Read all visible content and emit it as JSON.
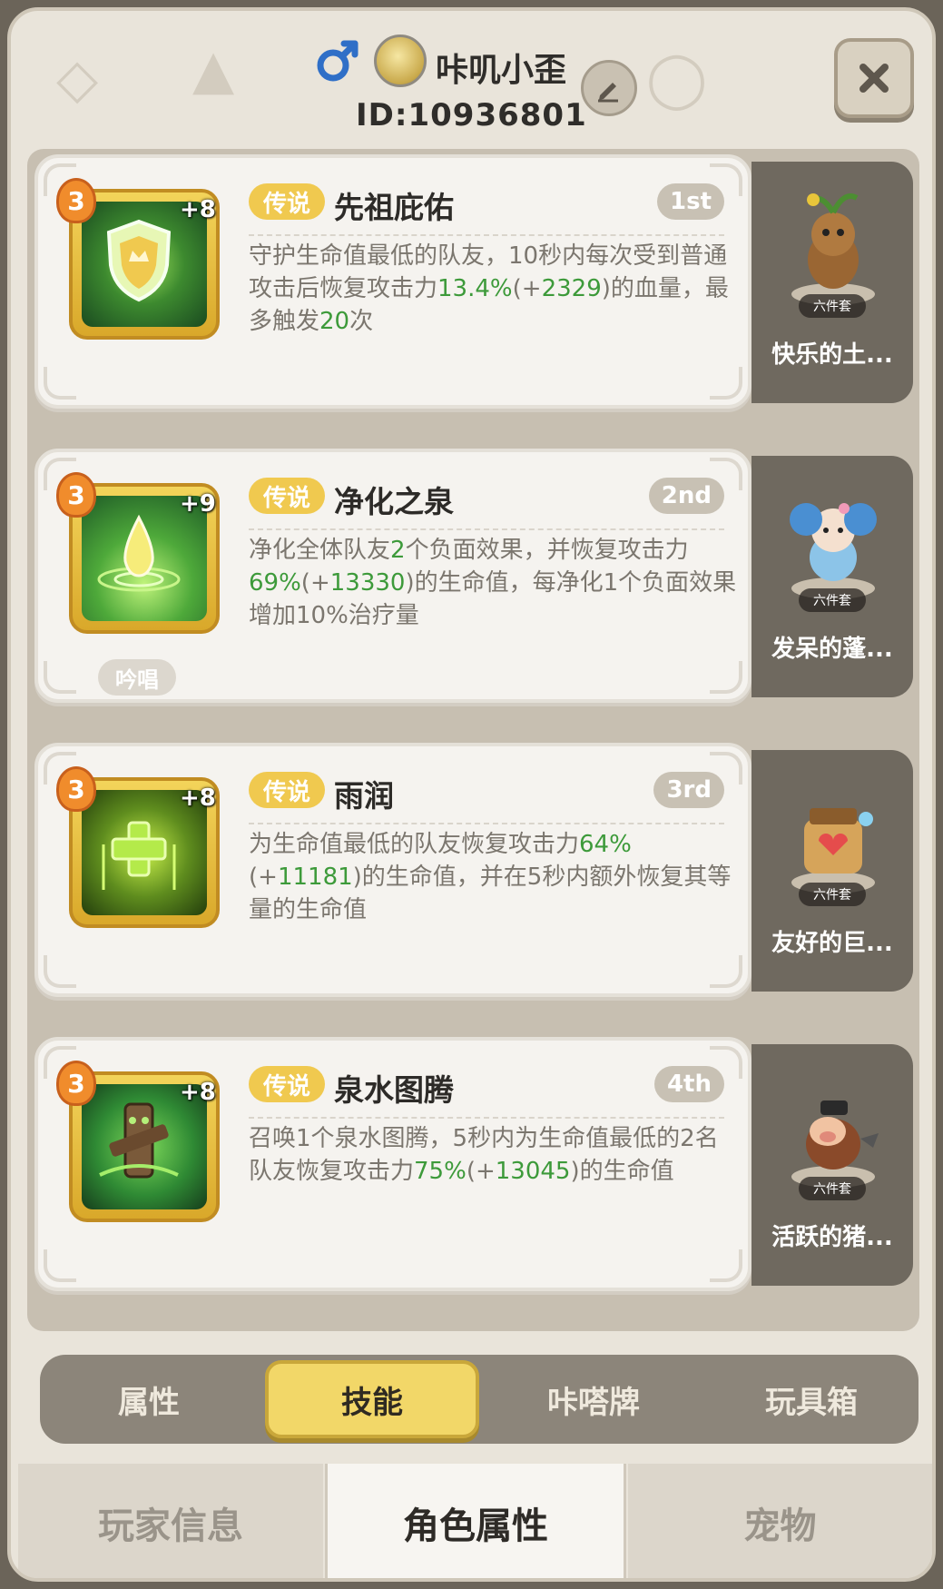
{
  "header": {
    "player_name": "咔叽小歪",
    "player_id": "ID:10936801",
    "gender": "male",
    "icons": {
      "gender": "male-symbol-icon",
      "edit": "pencil-icon",
      "close": "close-icon"
    }
  },
  "skills": [
    {
      "level": "3",
      "plus": "+8",
      "rarity": "传说",
      "name": "先祖庇佑",
      "rank": "1st",
      "desc_parts": [
        {
          "t": "守护生命值最低的队友，10秒内每次受到普通攻击后恢复攻击力"
        },
        {
          "t": "13.4%",
          "hl": true
        },
        {
          "t": "(+"
        },
        {
          "t": "2329",
          "hl": true
        },
        {
          "t": ")的血量，最多触发"
        },
        {
          "t": "20",
          "hl": true
        },
        {
          "t": "次"
        }
      ],
      "chant": "",
      "pet": {
        "set_tag": "六件套",
        "name": "快乐的土..."
      },
      "icon_colors": [
        "#1f5d2a",
        "#7fd34a"
      ],
      "icon_name": "shield-crown-icon"
    },
    {
      "level": "3",
      "plus": "+9",
      "rarity": "传说",
      "name": "净化之泉",
      "rank": "2nd",
      "desc_parts": [
        {
          "t": "净化全体队友"
        },
        {
          "t": "2",
          "hl": true
        },
        {
          "t": "个负面效果，并恢复攻击力"
        },
        {
          "t": "69%",
          "hl": true
        },
        {
          "t": "(+"
        },
        {
          "t": "13330",
          "hl": true
        },
        {
          "t": ")的生命值，每净化1个负面效果增加10%治疗量"
        }
      ],
      "chant": "吟唱",
      "pet": {
        "set_tag": "六件套",
        "name": "发呆的蓬..."
      },
      "icon_colors": [
        "#1e6b2c",
        "#a9e35a"
      ],
      "icon_name": "water-drop-icon"
    },
    {
      "level": "3",
      "plus": "+8",
      "rarity": "传说",
      "name": "雨润",
      "rank": "3rd",
      "desc_parts": [
        {
          "t": "为生命值最低的队友恢复攻击力"
        },
        {
          "t": "64%",
          "hl": true
        },
        {
          "t": "(+"
        },
        {
          "t": "11181",
          "hl": true
        },
        {
          "t": ")的生命值，并在5秒内额外恢复其等量的生命值"
        }
      ],
      "chant": "",
      "pet": {
        "set_tag": "六件套",
        "name": "友好的巨..."
      },
      "icon_colors": [
        "#2b4a12",
        "#b7e43a"
      ],
      "icon_name": "healing-cross-icon"
    },
    {
      "level": "3",
      "plus": "+8",
      "rarity": "传说",
      "name": "泉水图腾",
      "rank": "4th",
      "desc_parts": [
        {
          "t": "召唤1个泉水图腾，5秒内为生命值最低的2名队友恢复攻击力"
        },
        {
          "t": "75%",
          "hl": true
        },
        {
          "t": "(+"
        },
        {
          "t": "13045",
          "hl": true
        },
        {
          "t": ")的生命值"
        }
      ],
      "chant": "",
      "pet": {
        "set_tag": "六件套",
        "name": "活跃的猪..."
      },
      "icon_colors": [
        "#1f5a28",
        "#6fd24a"
      ],
      "icon_name": "totem-icon"
    }
  ],
  "sub_tabs": [
    "属性",
    "技能",
    "咔嗒牌",
    "玩具箱"
  ],
  "sub_tab_active": 1,
  "bottom_tabs": [
    "玩家信息",
    "角色属性",
    "宠物"
  ],
  "bottom_tab_active": 1,
  "colors": {
    "highlight_green": "#3d9a3a",
    "rarity_gold": "#f0c94f",
    "active_tab_yellow": "#f2d768"
  }
}
